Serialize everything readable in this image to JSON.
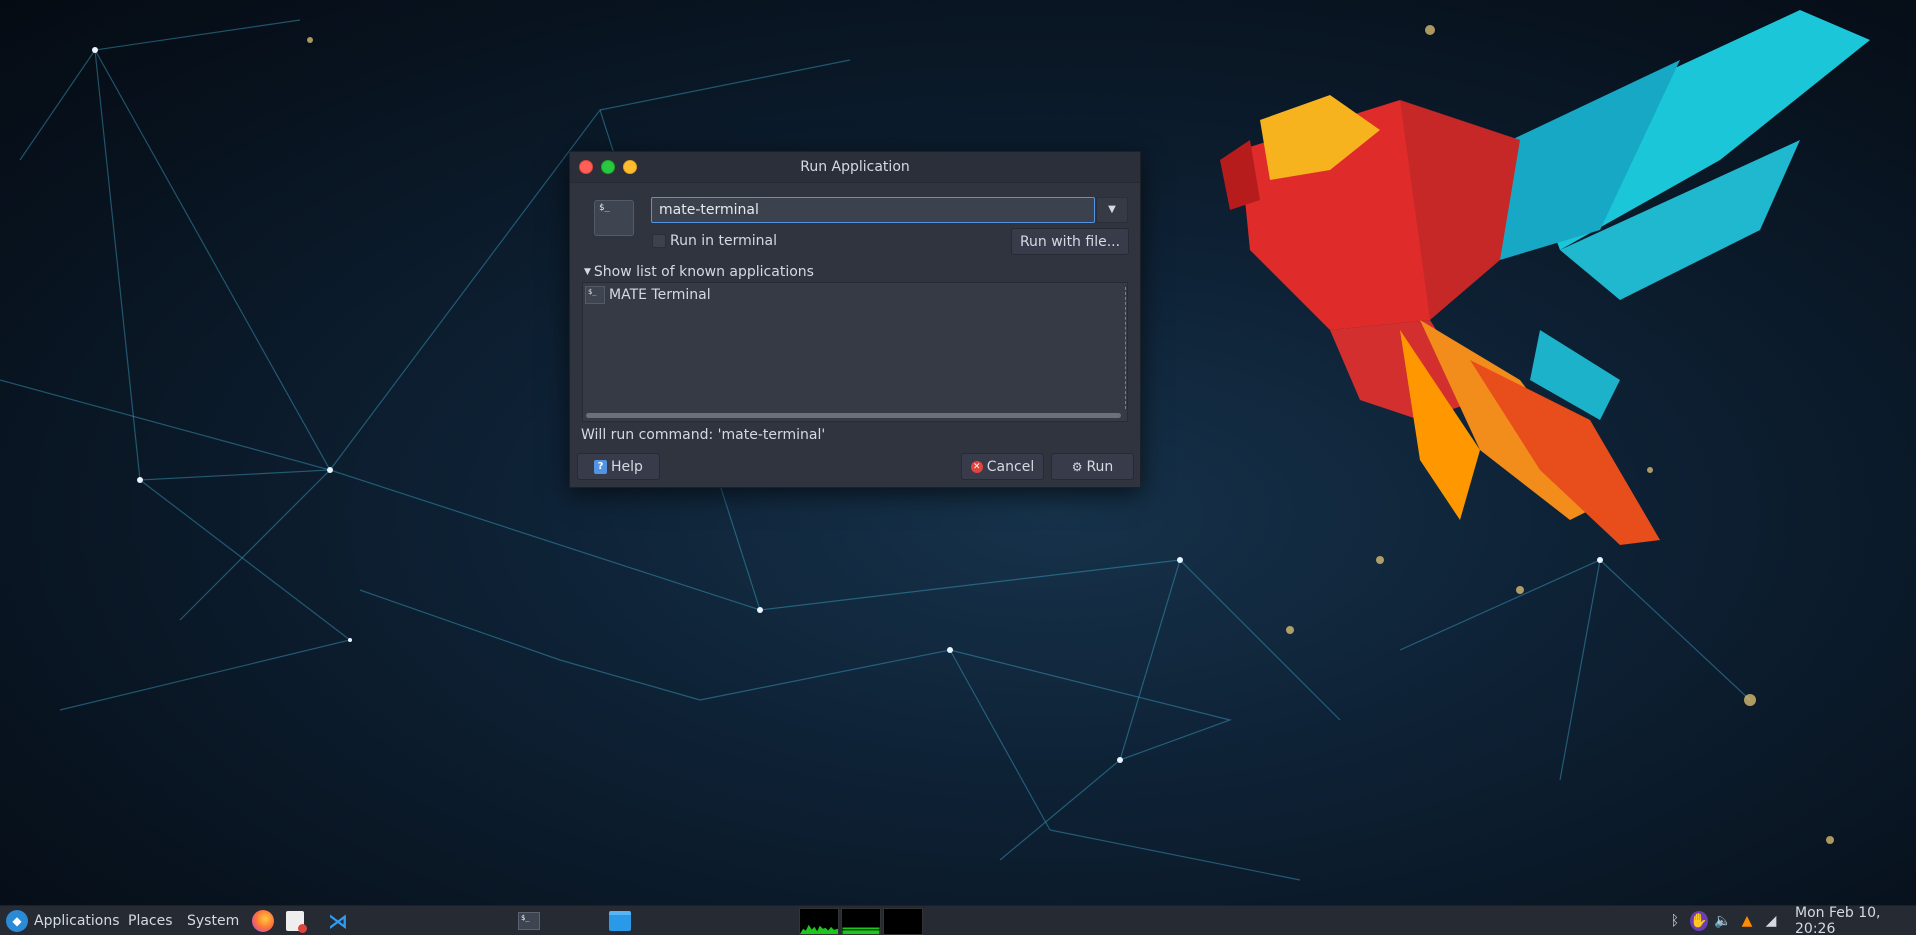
{
  "dialog": {
    "title": "Run Application",
    "command_value": "mate-terminal",
    "app_icon_glyph": "$_",
    "run_in_terminal_label": "Run in terminal",
    "run_in_terminal_checked": false,
    "run_with_file_label": "Run with file...",
    "expander_label": "Show list of known applications",
    "apps": [
      {
        "label": "MATE Terminal",
        "icon": "terminal-icon"
      }
    ],
    "status_text": "Will run command: 'mate-terminal'",
    "help_label": "Help",
    "cancel_label": "Cancel",
    "run_label": "Run"
  },
  "taskbar": {
    "applications_label": "Applications",
    "places_label": "Places",
    "system_label": "System",
    "launchers": [
      "firefox-icon",
      "document-viewer-icon",
      "vscode-icon"
    ],
    "tasks": [
      "terminal-icon",
      "file-manager-icon"
    ],
    "tray": [
      "bluetooth-icon",
      "hand-icon",
      "volume-icon",
      "vlc-icon",
      "wifi-icon"
    ],
    "clock": "Mon Feb 10, 20:26"
  },
  "colors": {
    "accent": "#5294e2",
    "dialog_bg": "#2f343f",
    "panel_bg": "#252a33",
    "close": "#ff5f57",
    "maximize": "#28c840",
    "minimize": "#febc2e"
  }
}
